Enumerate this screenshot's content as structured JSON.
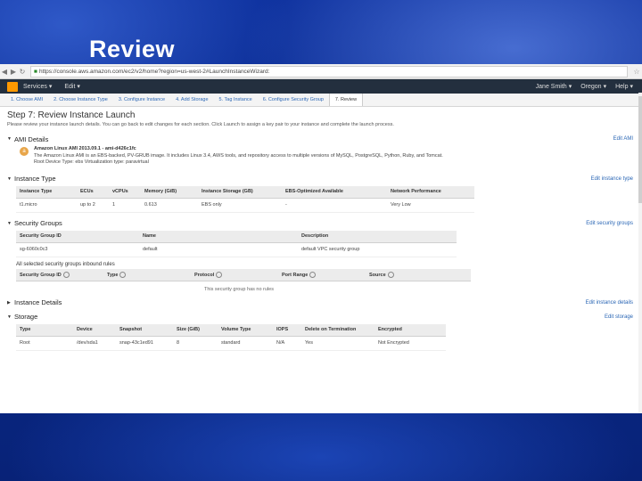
{
  "slide": {
    "title": "Review"
  },
  "browser": {
    "url": "https://console.aws.amazon.com/ec2/v2/home?region=us-west-2#LaunchInstanceWizard:"
  },
  "aws_nav": {
    "services_label": "Services",
    "edit_label": "Edit",
    "user_label": "Jane Smith",
    "region_label": "Oregon",
    "help_label": "Help"
  },
  "wizard": {
    "steps": [
      "1. Choose AMI",
      "2. Choose Instance Type",
      "3. Configure Instance",
      "4. Add Storage",
      "5. Tag Instance",
      "6. Configure Security Group",
      "7. Review"
    ]
  },
  "page": {
    "title": "Step 7: Review Instance Launch",
    "description": "Please review your instance launch details. You can go back to edit changes for each section. Click Launch to assign a key pair to your instance and complete the launch process."
  },
  "ami": {
    "heading": "AMI Details",
    "edit": "Edit AMI",
    "name": "Amazon Linux AMI 2013.09.1 - ami-d426c1fc",
    "description": "The Amazon Linux AMI is an EBS-backed, PV-GRUB image. It includes Linux 3.4, AWS tools, and repository access to multiple versions of MySQL, PostgreSQL, Python, Ruby, and Tomcat.",
    "root_device": "Root Device Type: ebs    Virtualization type: paravirtual"
  },
  "instance_type": {
    "heading": "Instance Type",
    "edit": "Edit instance type",
    "columns": [
      "Instance Type",
      "ECUs",
      "vCPUs",
      "Memory (GiB)",
      "Instance Storage (GB)",
      "EBS-Optimized Available",
      "Network Performance"
    ],
    "row": [
      "t1.micro",
      "up to 2",
      "1",
      "0.613",
      "EBS only",
      "-",
      "Very Low"
    ]
  },
  "security_groups": {
    "heading": "Security Groups",
    "edit": "Edit security groups",
    "columns": [
      "Security Group ID",
      "Name",
      "Description"
    ],
    "row": [
      "sg-6060c0c3",
      "default",
      "default VPC security group"
    ],
    "rules_label": "All selected security groups inbound rules",
    "rule_columns": [
      "Security Group ID",
      "Type",
      "Protocol",
      "Port Range",
      "Source"
    ],
    "no_rules": "This security group has no rules"
  },
  "instance_details": {
    "heading": "Instance Details",
    "edit": "Edit instance details"
  },
  "storage": {
    "heading": "Storage",
    "edit": "Edit storage",
    "columns": [
      "Type",
      "Device",
      "Snapshot",
      "Size (GiB)",
      "Volume Type",
      "IOPS",
      "Delete on Termination",
      "Encrypted"
    ],
    "row": [
      "Root",
      "/dev/sda1",
      "snap-43c1ed91",
      "8",
      "standard",
      "N/A",
      "Yes",
      "Not Encrypted"
    ]
  }
}
